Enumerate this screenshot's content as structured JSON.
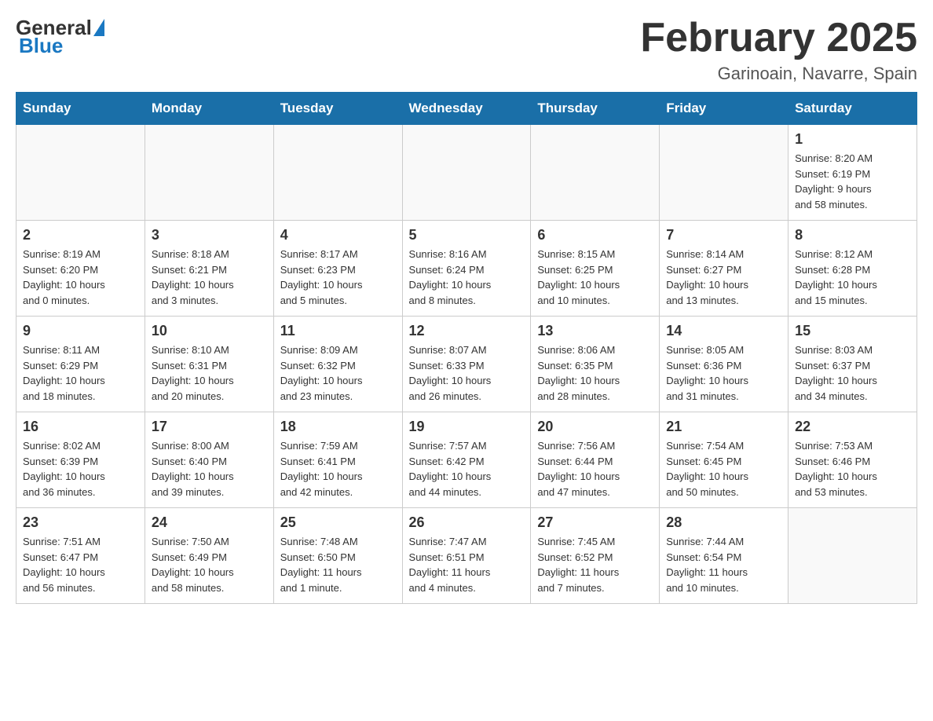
{
  "logo": {
    "general": "General",
    "blue": "Blue"
  },
  "header": {
    "title": "February 2025",
    "subtitle": "Garinoain, Navarre, Spain"
  },
  "weekdays": [
    "Sunday",
    "Monday",
    "Tuesday",
    "Wednesday",
    "Thursday",
    "Friday",
    "Saturday"
  ],
  "weeks": [
    [
      {
        "day": "",
        "info": ""
      },
      {
        "day": "",
        "info": ""
      },
      {
        "day": "",
        "info": ""
      },
      {
        "day": "",
        "info": ""
      },
      {
        "day": "",
        "info": ""
      },
      {
        "day": "",
        "info": ""
      },
      {
        "day": "1",
        "info": "Sunrise: 8:20 AM\nSunset: 6:19 PM\nDaylight: 9 hours\nand 58 minutes."
      }
    ],
    [
      {
        "day": "2",
        "info": "Sunrise: 8:19 AM\nSunset: 6:20 PM\nDaylight: 10 hours\nand 0 minutes."
      },
      {
        "day": "3",
        "info": "Sunrise: 8:18 AM\nSunset: 6:21 PM\nDaylight: 10 hours\nand 3 minutes."
      },
      {
        "day": "4",
        "info": "Sunrise: 8:17 AM\nSunset: 6:23 PM\nDaylight: 10 hours\nand 5 minutes."
      },
      {
        "day": "5",
        "info": "Sunrise: 8:16 AM\nSunset: 6:24 PM\nDaylight: 10 hours\nand 8 minutes."
      },
      {
        "day": "6",
        "info": "Sunrise: 8:15 AM\nSunset: 6:25 PM\nDaylight: 10 hours\nand 10 minutes."
      },
      {
        "day": "7",
        "info": "Sunrise: 8:14 AM\nSunset: 6:27 PM\nDaylight: 10 hours\nand 13 minutes."
      },
      {
        "day": "8",
        "info": "Sunrise: 8:12 AM\nSunset: 6:28 PM\nDaylight: 10 hours\nand 15 minutes."
      }
    ],
    [
      {
        "day": "9",
        "info": "Sunrise: 8:11 AM\nSunset: 6:29 PM\nDaylight: 10 hours\nand 18 minutes."
      },
      {
        "day": "10",
        "info": "Sunrise: 8:10 AM\nSunset: 6:31 PM\nDaylight: 10 hours\nand 20 minutes."
      },
      {
        "day": "11",
        "info": "Sunrise: 8:09 AM\nSunset: 6:32 PM\nDaylight: 10 hours\nand 23 minutes."
      },
      {
        "day": "12",
        "info": "Sunrise: 8:07 AM\nSunset: 6:33 PM\nDaylight: 10 hours\nand 26 minutes."
      },
      {
        "day": "13",
        "info": "Sunrise: 8:06 AM\nSunset: 6:35 PM\nDaylight: 10 hours\nand 28 minutes."
      },
      {
        "day": "14",
        "info": "Sunrise: 8:05 AM\nSunset: 6:36 PM\nDaylight: 10 hours\nand 31 minutes."
      },
      {
        "day": "15",
        "info": "Sunrise: 8:03 AM\nSunset: 6:37 PM\nDaylight: 10 hours\nand 34 minutes."
      }
    ],
    [
      {
        "day": "16",
        "info": "Sunrise: 8:02 AM\nSunset: 6:39 PM\nDaylight: 10 hours\nand 36 minutes."
      },
      {
        "day": "17",
        "info": "Sunrise: 8:00 AM\nSunset: 6:40 PM\nDaylight: 10 hours\nand 39 minutes."
      },
      {
        "day": "18",
        "info": "Sunrise: 7:59 AM\nSunset: 6:41 PM\nDaylight: 10 hours\nand 42 minutes."
      },
      {
        "day": "19",
        "info": "Sunrise: 7:57 AM\nSunset: 6:42 PM\nDaylight: 10 hours\nand 44 minutes."
      },
      {
        "day": "20",
        "info": "Sunrise: 7:56 AM\nSunset: 6:44 PM\nDaylight: 10 hours\nand 47 minutes."
      },
      {
        "day": "21",
        "info": "Sunrise: 7:54 AM\nSunset: 6:45 PM\nDaylight: 10 hours\nand 50 minutes."
      },
      {
        "day": "22",
        "info": "Sunrise: 7:53 AM\nSunset: 6:46 PM\nDaylight: 10 hours\nand 53 minutes."
      }
    ],
    [
      {
        "day": "23",
        "info": "Sunrise: 7:51 AM\nSunset: 6:47 PM\nDaylight: 10 hours\nand 56 minutes."
      },
      {
        "day": "24",
        "info": "Sunrise: 7:50 AM\nSunset: 6:49 PM\nDaylight: 10 hours\nand 58 minutes."
      },
      {
        "day": "25",
        "info": "Sunrise: 7:48 AM\nSunset: 6:50 PM\nDaylight: 11 hours\nand 1 minute."
      },
      {
        "day": "26",
        "info": "Sunrise: 7:47 AM\nSunset: 6:51 PM\nDaylight: 11 hours\nand 4 minutes."
      },
      {
        "day": "27",
        "info": "Sunrise: 7:45 AM\nSunset: 6:52 PM\nDaylight: 11 hours\nand 7 minutes."
      },
      {
        "day": "28",
        "info": "Sunrise: 7:44 AM\nSunset: 6:54 PM\nDaylight: 11 hours\nand 10 minutes."
      },
      {
        "day": "",
        "info": ""
      }
    ]
  ]
}
